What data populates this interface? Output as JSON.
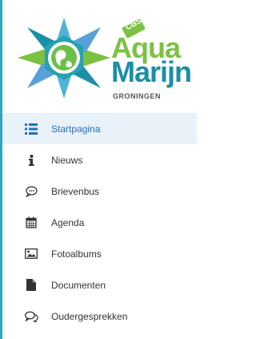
{
  "logo": {
    "icon_name": "globe-star-logo",
    "badge": "CBS",
    "line1": "Aqua",
    "line2": "Marijn",
    "line3": "GRONINGEN",
    "colors": {
      "green": "#7cc142",
      "teal": "#1c8ea6",
      "blue": "#5aa0d8"
    }
  },
  "menu": {
    "items": [
      {
        "label": "Startpagina",
        "icon": "list-icon",
        "active": true
      },
      {
        "label": "Nieuws",
        "icon": "info-icon",
        "active": false
      },
      {
        "label": "Brievenbus",
        "icon": "chat-bubble-icon",
        "active": false
      },
      {
        "label": "Agenda",
        "icon": "calendar-icon",
        "active": false
      },
      {
        "label": "Fotoalbums",
        "icon": "picture-icon",
        "active": false
      },
      {
        "label": "Documenten",
        "icon": "document-icon",
        "active": false
      },
      {
        "label": "Oudergesprekken",
        "icon": "conversation-icon",
        "active": false
      }
    ]
  },
  "colors": {
    "accent": "#1f6fbf",
    "active_bg": "#e9f2f9",
    "edge": "#2ea6c0"
  }
}
